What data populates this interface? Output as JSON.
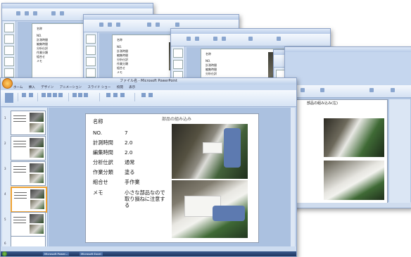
{
  "back_windows": [
    {
      "title": ""
    },
    {
      "title": ""
    },
    {
      "title": ""
    },
    {
      "title": ""
    }
  ],
  "main_window": {
    "title": "ファイル名 - Microsoft PowerPoint",
    "tabs": [
      "ホーム",
      "挿入",
      "デザイン",
      "アニメーション",
      "スライド ショー",
      "校閲",
      "表示"
    ],
    "slide": {
      "title": "部品の組み込み",
      "name_label": "名称",
      "rows": [
        {
          "label": "NO.",
          "value": "7"
        },
        {
          "label": "計測時間",
          "value": "2.0"
        },
        {
          "label": "編集時間",
          "value": "2.0"
        },
        {
          "label": "分析仕訳",
          "value": "通常"
        },
        {
          "label": "作業分類",
          "value": "塗る"
        },
        {
          "label": "組合せ",
          "value": "手作業"
        }
      ],
      "memo_label": "メモ",
      "memo_value": "小さな部品なので取り損ねに注意する"
    },
    "thumbnails": [
      {
        "num": "1"
      },
      {
        "num": "2"
      },
      {
        "num": "3"
      },
      {
        "num": "4"
      },
      {
        "num": "5"
      },
      {
        "num": "6"
      }
    ],
    "taskbar": {
      "items": [
        "Microsoft Power...",
        "Microsoft Excel"
      ],
      "clock": ""
    }
  },
  "mini_slide_texts": {
    "name": "名称",
    "no": "NO.",
    "no_val": "6",
    "time1": "計測時間",
    "time1_val": "1.1",
    "time2": "編集時間",
    "time2_val": "1.1",
    "class1": "分析仕訳",
    "class1_val": "通常",
    "class2": "作業分類",
    "class2_val": "塗る",
    "combo": "組合せ",
    "combo_val": "手作業",
    "memo": "メモ"
  },
  "right_window": {
    "slide_title": "部品の組み込み(左)"
  }
}
